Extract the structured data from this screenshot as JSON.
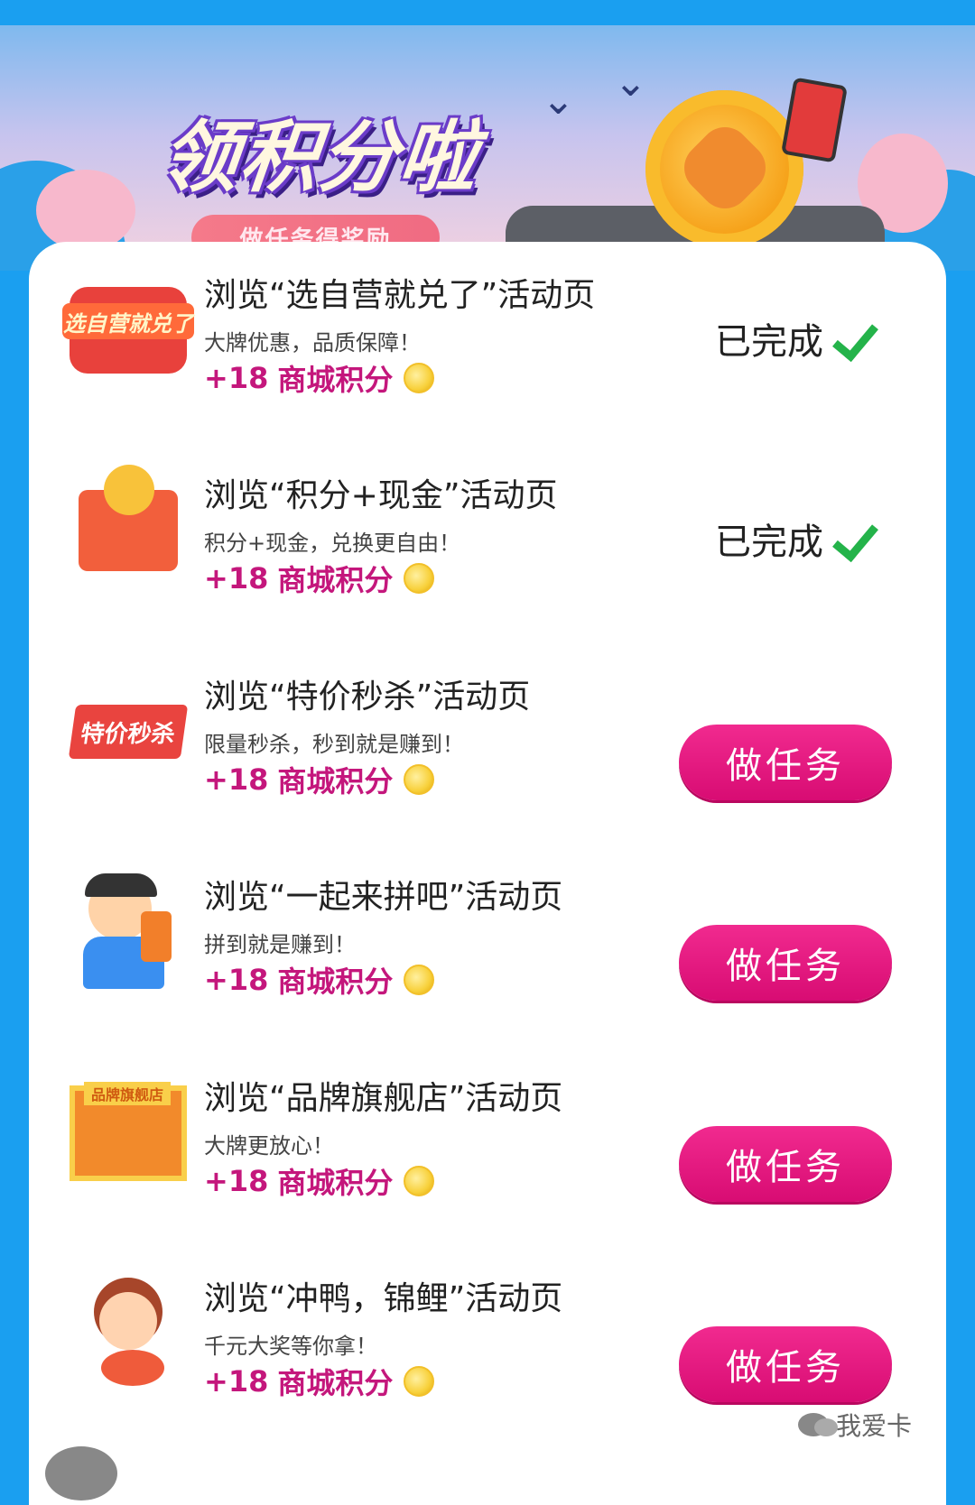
{
  "banner": {
    "title": "领积分啦",
    "subtitle": "做任务得奖励"
  },
  "tasks": [
    {
      "title": "浏览“选自营就兑了”活动页",
      "desc": "大牌优惠，品质保障！",
      "points": "+18",
      "points_unit": "商城积分",
      "status": "已完成",
      "icon_label": "选自营就兑了",
      "icon": "promo-badge-icon"
    },
    {
      "title": "浏览“积分+现金”活动页",
      "desc": "积分+现金，兑换更自由！",
      "points": "+18",
      "points_unit": "商城积分",
      "status": "已完成",
      "icon": "gift-box-icon"
    },
    {
      "title": "浏览“特价秒杀”活动页",
      "desc": "限量秒杀，秒到就是赚到！",
      "points": "+18",
      "points_unit": "商城积分",
      "action": "做任务",
      "icon_label": "特价秒杀",
      "icon": "flash-sale-icon"
    },
    {
      "title": "浏览“一起来拼吧”活动页",
      "desc": "拼到就是赚到！",
      "points": "+18",
      "points_unit": "商城积分",
      "action": "做任务",
      "icon": "delivery-person-icon"
    },
    {
      "title": "浏览“品牌旗舰店”活动页",
      "desc": "大牌更放心！",
      "points": "+18",
      "points_unit": "商城积分",
      "action": "做任务",
      "icon_label": "品牌旗舰店",
      "icon": "storefront-icon"
    },
    {
      "title": "浏览“冲鸭，锦鲤”活动页",
      "desc": "千元大奖等你拿！",
      "points": "+18",
      "points_unit": "商城积分",
      "action": "做任务",
      "icon": "koi-girl-icon"
    }
  ],
  "watermark": "我爱卡",
  "colors": {
    "background": "#1a9ff0",
    "button": "#e0137b",
    "points_text": "#c4177c",
    "check": "#24b34a"
  }
}
